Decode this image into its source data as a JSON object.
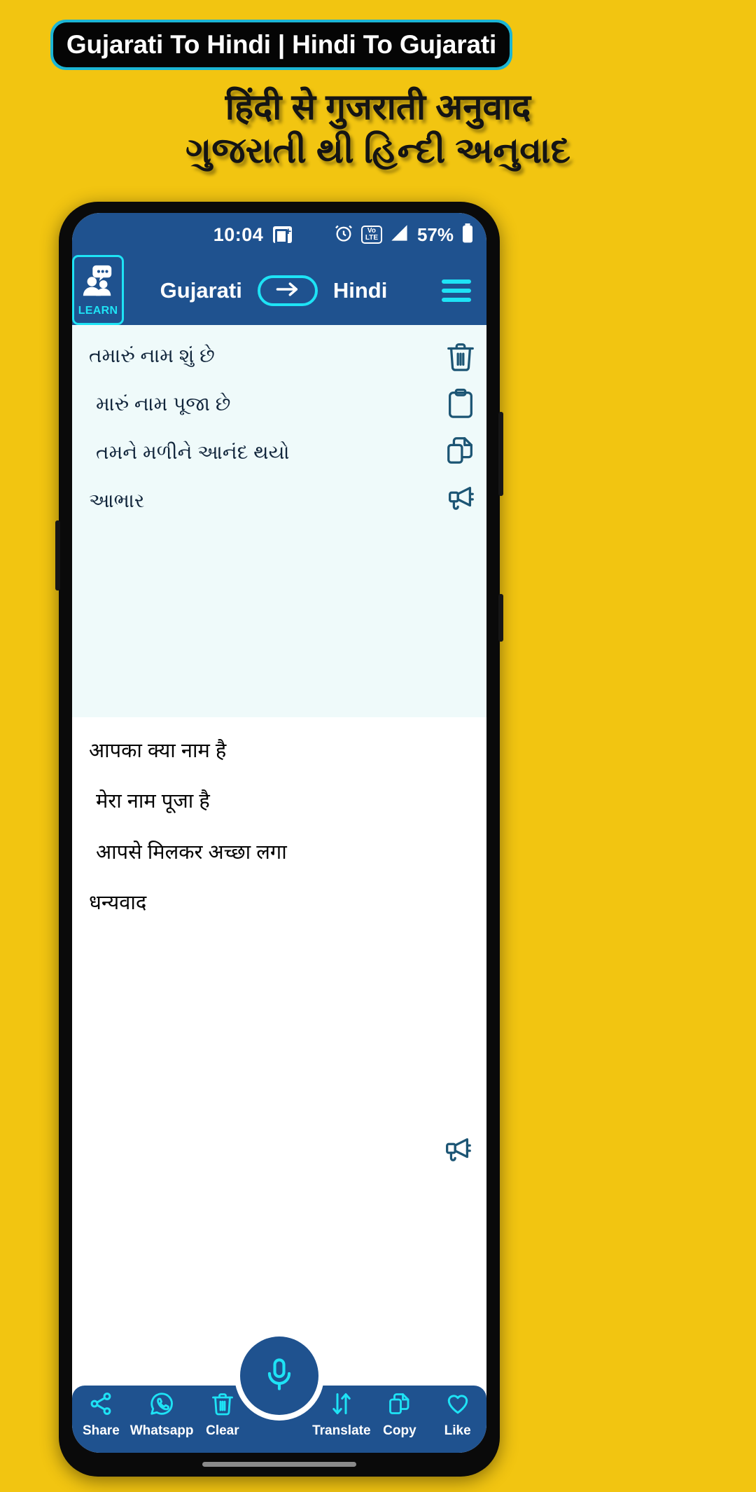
{
  "promo": {
    "banner_title": "Gujarati To Hindi | Hindi To Gujarati",
    "subtitle_line1": "हिंदी से गुजराती अनुवाद",
    "subtitle_line2": "ગુજરાતી થી હિન્દી અનુવાદ",
    "background_color": "#F2C511",
    "banner_border_color": "#1CB5D4",
    "banner_fill_color": "#050505"
  },
  "statusbar": {
    "time": "10:04",
    "notification_icon": "outlook-icon",
    "alarm_icon": "alarm-icon",
    "volte_top": "Vo",
    "volte_bottom": "LTE",
    "signal_icon": "signal-icon",
    "battery_percent": "57%",
    "battery_icon": "battery-icon"
  },
  "appbar": {
    "learn_label": "LEARN",
    "learn_icon": "people-chat-icon",
    "source_language": "Gujarati",
    "target_language": "Hindi",
    "swap_icon": "arrow-right-icon",
    "menu_icon": "hamburger-menu-icon",
    "accent_color": "#1EE3F5",
    "bar_color": "#1F528F"
  },
  "source": {
    "lines": [
      "તમારું નામ શું છે",
      "મારું નામ પૂજા છે",
      "તમને મળીને આનંદ થયો",
      "આભાર"
    ],
    "background_color": "#EFFAFA",
    "tools": [
      {
        "name": "delete-icon",
        "label": "Delete"
      },
      {
        "name": "paste-icon",
        "label": "Paste"
      },
      {
        "name": "copy-icon",
        "label": "Copy"
      },
      {
        "name": "speak-icon",
        "label": "Speak"
      }
    ]
  },
  "target": {
    "lines": [
      "आपका क्या नाम है",
      "मेरा नाम पूजा है",
      "आपसे मिलकर अच्छा लगा",
      "धन्यवाद"
    ],
    "speak_icon": "speak-icon",
    "background_color": "#ffffff"
  },
  "bottomnav": {
    "items": [
      {
        "icon": "share-icon",
        "label": "Share"
      },
      {
        "icon": "whatsapp-icon",
        "label": "Whatsapp"
      },
      {
        "icon": "trash-icon",
        "label": "Clear"
      },
      {
        "icon": "translate-icon",
        "label": "Translate"
      },
      {
        "icon": "copy-icon",
        "label": "Copy"
      },
      {
        "icon": "heart-icon",
        "label": "Like"
      }
    ],
    "fab_icon": "microphone-icon",
    "bar_color": "#1F528F",
    "icon_color": "#1EE3F5"
  }
}
